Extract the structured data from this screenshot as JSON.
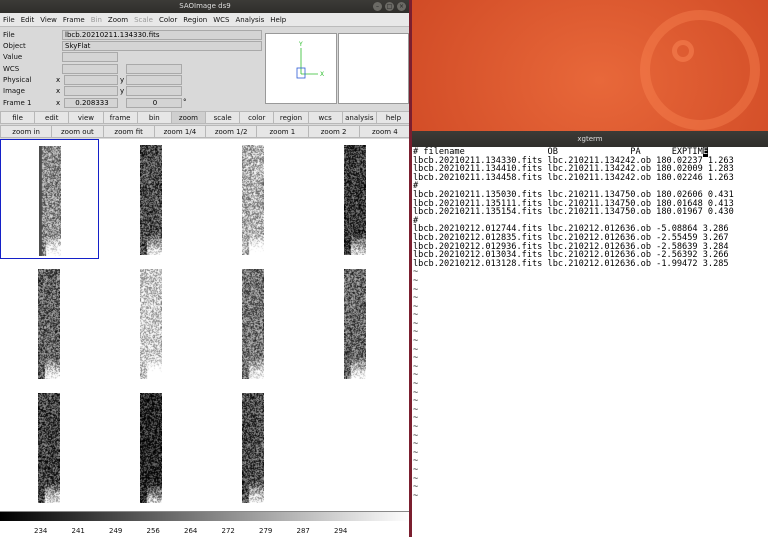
{
  "ds9": {
    "title": "SAOImage ds9",
    "menu": [
      "File",
      "Edit",
      "View",
      "Frame",
      "Bin",
      "Zoom",
      "Scale",
      "Color",
      "Region",
      "WCS",
      "Analysis",
      "Help"
    ],
    "menu_disabled": [
      "Bin",
      "Scale"
    ],
    "info": {
      "file_label": "File",
      "file_value": "lbcb.20210211.134330.fits",
      "object_label": "Object",
      "object_value": "SkyFlat",
      "value_label": "Value",
      "wcs_label": "WCS",
      "physical_label": "Physical",
      "image_label": "Image",
      "frame_label": "Frame 1",
      "x_label": "x",
      "y_label": "y",
      "zoom_value": "0.208333",
      "angle_value": "0",
      "degree_symbol": "°"
    },
    "buttons": [
      "file",
      "edit",
      "view",
      "frame",
      "bin",
      "zoom",
      "scale",
      "color",
      "region",
      "wcs",
      "analysis",
      "help"
    ],
    "active_button": "zoom",
    "zoom_buttons": [
      "zoom in",
      "zoom out",
      "zoom fit",
      "zoom 1/4",
      "zoom 1/2",
      "zoom 1",
      "zoom 2",
      "zoom 4"
    ],
    "colorbar_ticks": [
      "234",
      "241",
      "249",
      "256",
      "264",
      "272",
      "279",
      "287",
      "294"
    ],
    "panner_axes": {
      "x": "X",
      "y": "Y"
    }
  },
  "xgterm": {
    "title": "xgterm",
    "header": "# filename                OB              PA      EXPTIM",
    "cursor_char": "E",
    "lines": [
      "lbcb.20210211.134330.fits lbc.210211.134242.ob 180.02237 1.263",
      "lbcb.20210211.134410.fits lbc.210211.134242.ob 180.02009 1.283",
      "lbcb.20210211.134458.fits lbc.210211.134242.ob 180.02246 1.263",
      "#",
      "lbcb.20210211.135030.fits lbc.210211.134750.ob 180.02606 0.431",
      "lbcb.20210211.135111.fits lbc.210211.134750.ob 180.01648 0.413",
      "lbcb.20210211.135154.fits lbc.210211.134750.ob 180.01967 0.430",
      "#",
      "lbcb.20210212.012744.fits lbc.210212.012636.ob -5.08864 3.286",
      "lbcb.20210212.012835.fits lbc.210212.012636.ob -2.55459 3.267",
      "lbcb.20210212.012936.fits lbc.210212.012636.ob -2.58639 3.284",
      "lbcb.20210212.013034.fits lbc.210212.012636.ob -2.56392 3.266",
      "lbcb.20210212.013128.fits lbc.210212.012636.ob -1.99472 3.285"
    ],
    "tilde_count": 27
  }
}
